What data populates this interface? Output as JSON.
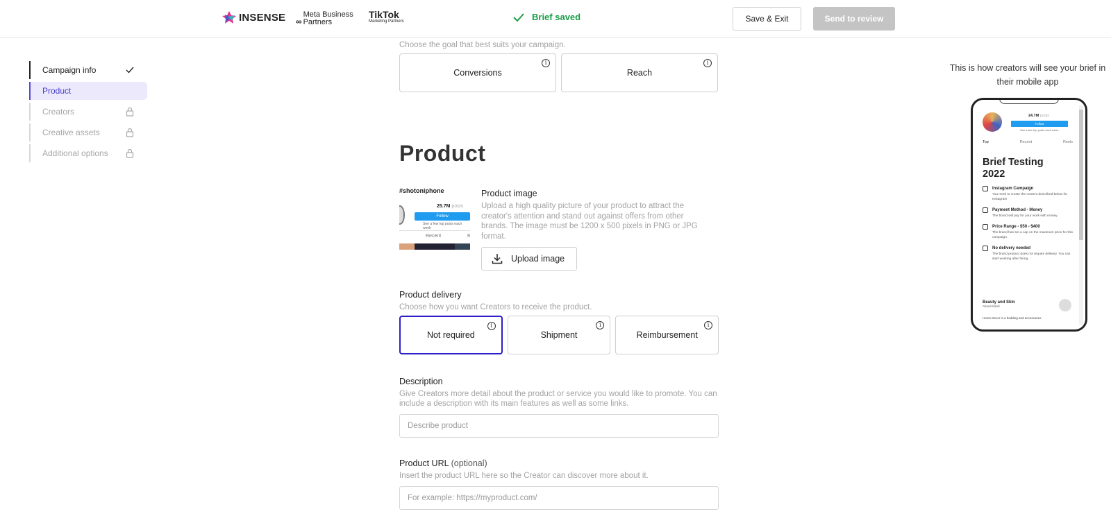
{
  "topbar": {
    "logo_insense": "INSENSE",
    "logo_meta": "Meta Business Partners",
    "logo_tiktok": "TikTok",
    "logo_tiktok_sub": "Marketing Partners",
    "saved_status": "Brief saved",
    "save_exit_label": "Save & Exit",
    "send_review_label": "Send to review",
    "saved_color": "#1a9e47"
  },
  "sidebar": {
    "items": [
      {
        "label": "Campaign info",
        "state": "done",
        "icon": "check-icon"
      },
      {
        "label": "Product",
        "state": "active",
        "icon": ""
      },
      {
        "label": "Creators",
        "state": "locked",
        "icon": "lock-icon"
      },
      {
        "label": "Creative assets",
        "state": "locked",
        "icon": "lock-icon"
      },
      {
        "label": "Additional options",
        "state": "locked",
        "icon": "lock-icon"
      }
    ],
    "active_color": "#4a3fd0"
  },
  "goal": {
    "hint": "Choose the goal that best suits your campaign.",
    "options": [
      "Conversions",
      "Reach"
    ]
  },
  "product": {
    "heading": "Product",
    "image": {
      "label": "Product image",
      "hint": "Upload a high quality picture of your product to attract the creator's attention and stand out against offers from other brands. The image must be 1200 x 500 pixels in PNG or JPG format.",
      "upload_label": "Upload image",
      "thumb_handle": "#shotoniphone",
      "thumb_posts": "25.7M",
      "thumb_posts_word": "posts",
      "thumb_follow": "Follow",
      "thumb_sub": "See a few top posts each week",
      "thumb_tab_recent": "Recent",
      "thumb_tab_reels": "R"
    },
    "delivery": {
      "label": "Product delivery",
      "hint": "Choose how you want Creators to receive the product.",
      "options": [
        "Not required",
        "Shipment",
        "Reimbursement"
      ],
      "selected": "Not required",
      "selected_color": "#2e1ec8"
    },
    "description": {
      "label": "Description",
      "hint": "Give Creators more detail about the product or service you would like to promote. You can include a description with its main features as well as some links.",
      "placeholder": "Describe product",
      "value": ""
    },
    "url": {
      "label": "Product URL",
      "label_optional": "(optional)",
      "hint": "Insert the product URL here so the Creator can discover more about it.",
      "placeholder": "For example: https://myproduct.com/",
      "value": ""
    }
  },
  "preview": {
    "caption": "This is how creators will see your brief in their mobile app",
    "posts": "24.7M",
    "posts_word": "posts",
    "follow": "Follow",
    "sub": "See a few top posts each week",
    "tabs": [
      "Top",
      "Recent",
      "Reels"
    ],
    "title": "Brief Testing 2022",
    "items": [
      {
        "title": "Instagram Campaign",
        "desc": "You need to create the content described below for Instagram"
      },
      {
        "title": "Payment Method - Money",
        "desc": "The brand will pay for your work with money."
      },
      {
        "title": "Price Range - $50 - $400",
        "desc": "The brand has set a cap on the maximum price for this campaign."
      },
      {
        "title": "No delivery needed",
        "desc": "The brand product does not require delivery. You can start working after hiring."
      }
    ],
    "category": "Beauty and Skin",
    "category_sub": "About brand",
    "footer": "Home Decor is a bedding and accessories"
  }
}
